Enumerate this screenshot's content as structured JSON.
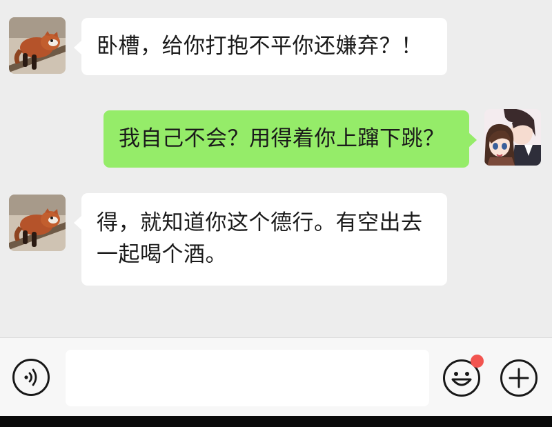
{
  "messages": [
    {
      "side": "left",
      "text": "卧槽，给你打抱不平你还嫌弃？！",
      "avatar": "red-panda-avatar"
    },
    {
      "side": "right",
      "text": "我自己不会？用得着你上蹿下跳？",
      "avatar": "anime-couple-avatar"
    },
    {
      "side": "left",
      "text_line1": "得，就知道你这个德行。有空出去",
      "text_line2": "一起喝个酒。",
      "avatar": "red-panda-avatar"
    }
  ],
  "input": {
    "value": "",
    "placeholder": ""
  },
  "icons": {
    "voice": "voice-icon",
    "emoji": "emoji-icon",
    "plus": "plus-icon"
  },
  "colors": {
    "chat_bg": "#ededed",
    "incoming_bubble": "#ffffff",
    "outgoing_bubble": "#95ec69",
    "badge": "#f2544f"
  },
  "emoji_badge_visible": true
}
